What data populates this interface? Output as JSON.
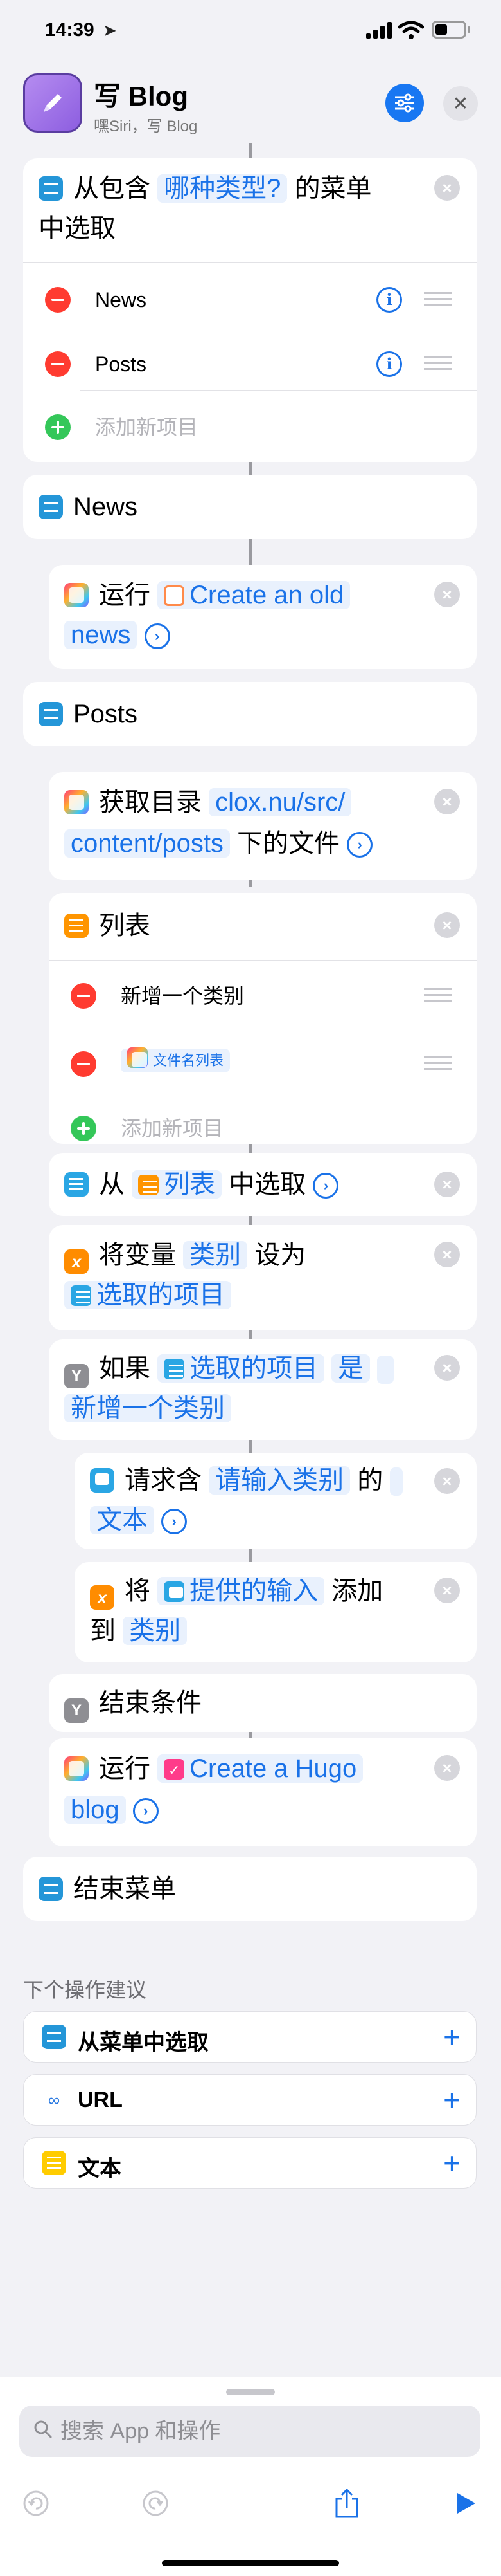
{
  "status_bar": {
    "time": "14:39",
    "location_icon": "location-arrow-icon"
  },
  "header": {
    "title": "写 Blog",
    "subtitle": "嘿Siri，写 Blog",
    "app_icon": "pencil-icon",
    "settings_icon": "sliders-icon",
    "close_icon": "close-icon"
  },
  "actions": {
    "menu_select": {
      "line1_a": "从包含",
      "prompt": "哪种类型?",
      "line1_b": "的菜单",
      "line2": "中选取"
    },
    "menu_items": [
      "News",
      "Posts"
    ],
    "add_item": "添加新项目",
    "case_news": "News",
    "run_old": {
      "verb": "运行",
      "shortcut_a": "Create an old",
      "shortcut_b": "news"
    },
    "case_posts": "Posts",
    "get_dir": {
      "verb": "获取目录",
      "path_a": "clox.nu/src/",
      "path_b": "content/posts",
      "tail": "下的文件"
    },
    "list": {
      "title": "列表",
      "items": [
        "新增一个类别"
      ],
      "token_item": "文件名列表",
      "add_item": "添加新项目"
    },
    "choose": {
      "a": "从",
      "token": "列表",
      "b": "中选取"
    },
    "set_var": {
      "a": "将变量",
      "var": "类别",
      "b": "设为",
      "value": "选取的项目"
    },
    "if": {
      "a": "如果",
      "token": "选取的项目",
      "op": "是",
      "value": "新增一个类别"
    },
    "ask": {
      "a": "请求含",
      "prompt": "请输入类别",
      "b": "的",
      "type": "文本"
    },
    "append": {
      "a": "将",
      "input": "提供的输入",
      "b": "添加",
      "c": "到",
      "var": "类别"
    },
    "end_if": "结束条件",
    "run_hugo": {
      "verb": "运行",
      "shortcut_a": "Create a Hugo",
      "shortcut_b": "blog"
    },
    "end_menu": "结束菜单"
  },
  "suggestions": {
    "title": "下个操作建议",
    "items": [
      {
        "label": "从菜单中选取",
        "icon": "menu-icon"
      },
      {
        "label": "URL",
        "icon": "link-icon"
      },
      {
        "label": "文本",
        "icon": "text-icon"
      }
    ]
  },
  "search": {
    "placeholder": "搜索 App 和操作"
  },
  "toolbar": {
    "undo": "undo-icon",
    "redo": "redo-icon",
    "share": "share-icon",
    "run": "play-icon"
  },
  "colors": {
    "accent": "#1a72e8",
    "background": "#f2f2f6",
    "remove": "#ff3b30",
    "add": "#34c759"
  }
}
